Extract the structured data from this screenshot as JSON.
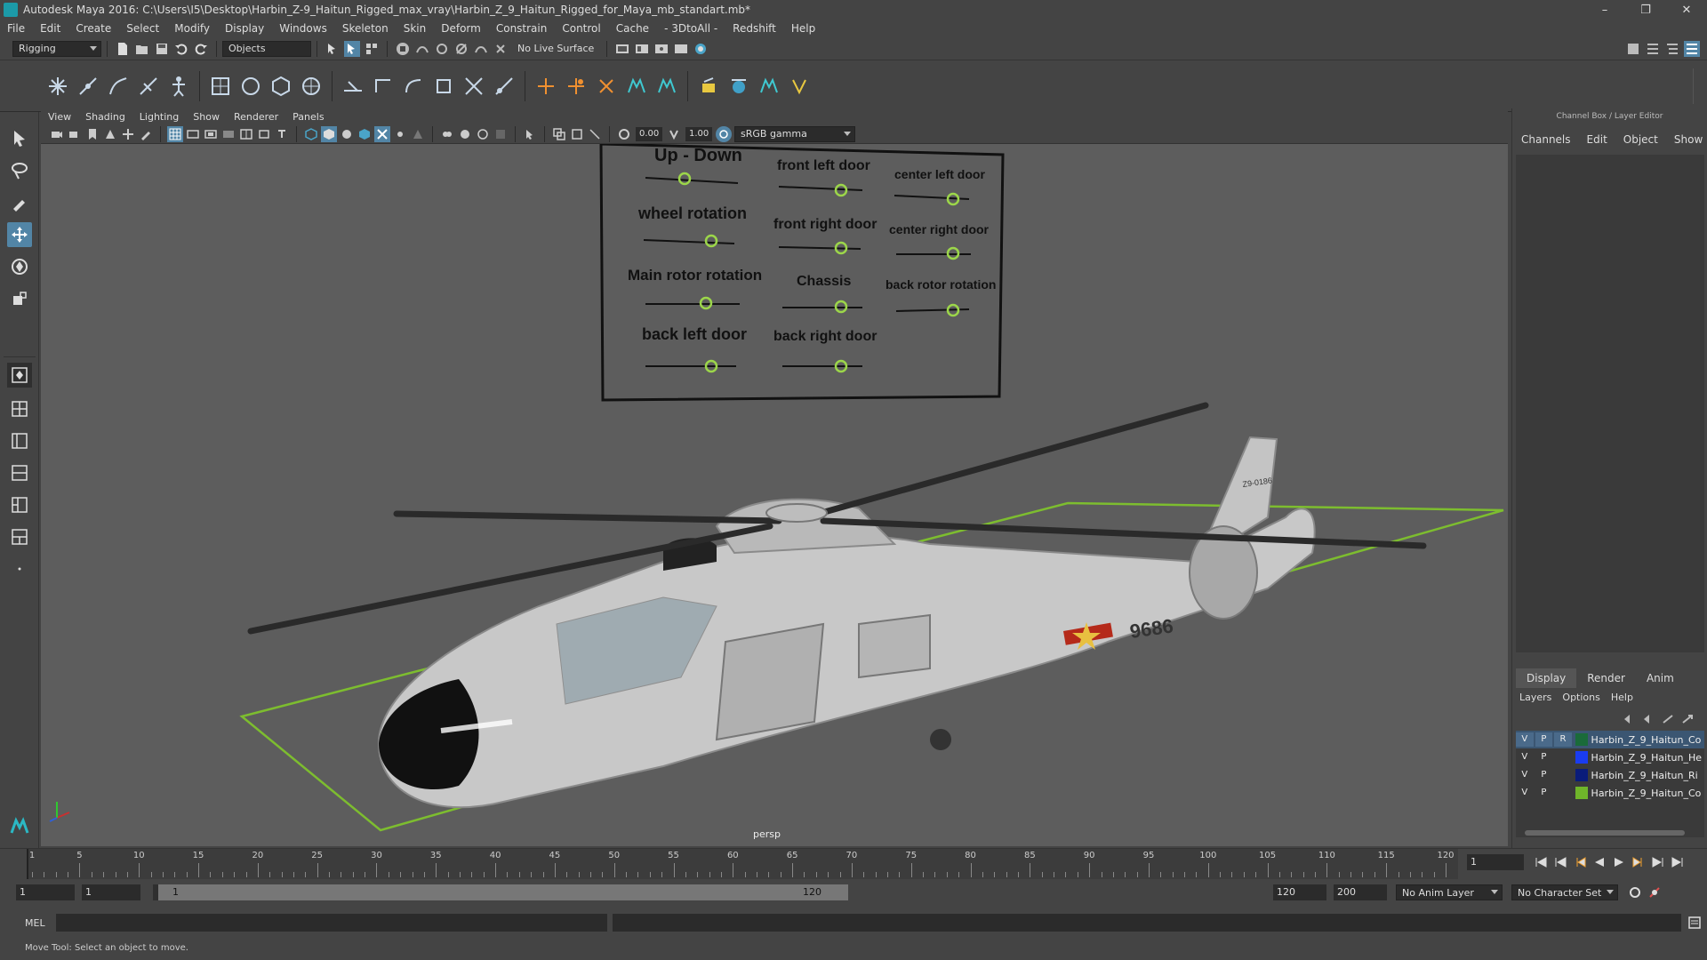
{
  "window": {
    "title": "Autodesk Maya 2016: C:\\Users\\I5\\Desktop\\Harbin_Z-9_Haitun_Rigged_max_vray\\Harbin_Z_9_Haitun_Rigged_for_Maya_mb_standart.mb*",
    "minimize": "–",
    "maximize": "❐",
    "close": "✕"
  },
  "menubar": [
    "File",
    "Edit",
    "Create",
    "Select",
    "Modify",
    "Display",
    "Windows",
    "Skeleton",
    "Skin",
    "Deform",
    "Constrain",
    "Control",
    "Cache",
    "- 3DtoAll -",
    "Redshift",
    "Help"
  ],
  "statusline": {
    "menuset": "Rigging",
    "selection_mode": "Objects",
    "live_surface": "No Live Surface"
  },
  "panel_menu": [
    "View",
    "Shading",
    "Lighting",
    "Show",
    "Renderer",
    "Panels"
  ],
  "view_toolbar": {
    "exposure": "0.00",
    "gamma": "1.00",
    "color_space": "sRGB gamma"
  },
  "viewport": {
    "camera": "persp",
    "control_board": {
      "labels": [
        "Up - Down",
        "front left door",
        "center left door",
        "wheel rotation",
        "front right door",
        "center right door",
        "Main rotor rotation",
        "Chassis",
        "back rotor rotation",
        "back left door",
        "back right door"
      ]
    },
    "tail_number": "9686",
    "tail_code": "Z9-0186",
    "colors": {
      "background": "#5d5d5d",
      "grid": "#7dbd2f",
      "helicopter": "#c8c8c8"
    }
  },
  "channel_box": {
    "title": "Channel Box / Layer Editor",
    "tabs": [
      "Channels",
      "Edit",
      "Object",
      "Show"
    ],
    "layer_tabs": [
      "Display",
      "Render",
      "Anim"
    ],
    "layer_menu": [
      "Layers",
      "Options",
      "Help"
    ],
    "layers": [
      {
        "v": "V",
        "p": "P",
        "r": "R",
        "color": "#1a6b3a",
        "name": "Harbin_Z_9_Haitun_Co"
      },
      {
        "v": "V",
        "p": "P",
        "r": "",
        "color": "#1a3cf0",
        "name": "Harbin_Z_9_Haitun_He"
      },
      {
        "v": "V",
        "p": "P",
        "r": "",
        "color": "#0a1c7a",
        "name": "Harbin_Z_9_Haitun_Ri"
      },
      {
        "v": "V",
        "p": "P",
        "r": "",
        "color": "#6fb52a",
        "name": "Harbin_Z_9_Haitun_Co"
      }
    ]
  },
  "timeline": {
    "ticks": [
      "1",
      "5",
      "10",
      "15",
      "20",
      "25",
      "30",
      "35",
      "40",
      "45",
      "50",
      "55",
      "60",
      "65",
      "70",
      "75",
      "80",
      "85",
      "90",
      "95",
      "100",
      "105",
      "110",
      "115",
      "120"
    ],
    "current_frame": "1"
  },
  "range": {
    "start": "1",
    "playback_start": "1",
    "slider_start": "1",
    "slider_end": "120",
    "playback_end": "120",
    "end": "200",
    "anim_layer": "No Anim Layer",
    "character_set": "No Character Set"
  },
  "command_line": {
    "language": "MEL"
  },
  "help_line": "Move Tool: Select an object to move."
}
